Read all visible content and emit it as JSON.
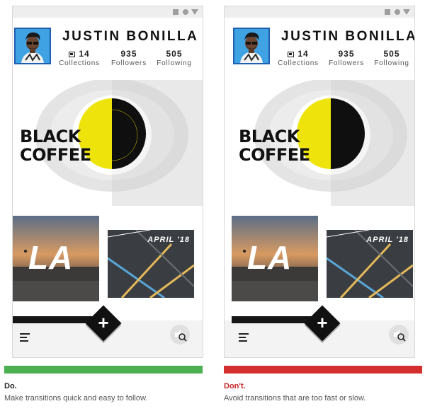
{
  "profile": {
    "name": "JUSTIN BONILLA",
    "stats": [
      {
        "value": "14",
        "label": "Collections"
      },
      {
        "value": "935",
        "label": "Followers"
      },
      {
        "value": "505",
        "label": "Following"
      }
    ]
  },
  "hero": {
    "line1": "BLACK",
    "line2": "COFFEE"
  },
  "tiles": {
    "la": "LA",
    "april": "APRIL '18"
  },
  "fab_symbol": "+",
  "icons": {
    "collections": "collections-icon",
    "menu": "menu-icon",
    "volume": "volume-icon",
    "search": "search-icon",
    "add": "plus-icon"
  },
  "colors": {
    "do": "#4caf50",
    "dont": "#d32f2f",
    "coffee_yellow": "#eee30b",
    "avatar_bg": "#3ea2e3"
  },
  "panels": [
    {
      "verdict": "Do.",
      "description": "Make transitions quick and easy to follow."
    },
    {
      "verdict": "Don't.",
      "description": "Avoid transitions that are too fast or slow."
    }
  ]
}
